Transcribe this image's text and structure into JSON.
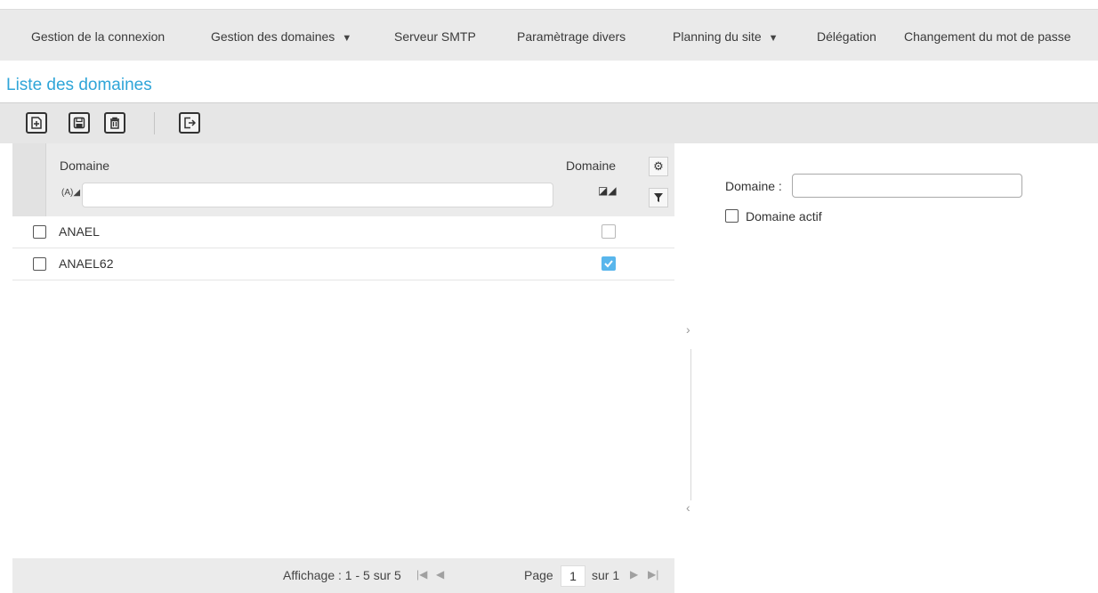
{
  "menu": {
    "items": [
      {
        "label": "Gestion de la connexion",
        "has_dropdown": false
      },
      {
        "label": "Gestion des domaines",
        "has_dropdown": true
      },
      {
        "label": "Serveur SMTP",
        "has_dropdown": false
      },
      {
        "label": "Paramètrage divers",
        "has_dropdown": false
      },
      {
        "label": "Planning du site",
        "has_dropdown": true
      },
      {
        "label": "Délégation",
        "has_dropdown": false
      },
      {
        "label": "Changement du mot de passe",
        "has_dropdown": false
      }
    ]
  },
  "page": {
    "title": "Liste des domaines"
  },
  "toolbar": {
    "buttons": [
      "new-icon",
      "save-icon",
      "delete-icon",
      "exit-icon"
    ]
  },
  "grid": {
    "columns": {
      "name": "Domaine",
      "active": "Domaine"
    },
    "filter_mode": "(A)",
    "rows": [
      {
        "name": "ANAEL",
        "active": false,
        "selected": false
      },
      {
        "name": "ANAEL62",
        "active": true,
        "selected": false
      }
    ]
  },
  "pager": {
    "info": "Affichage : 1 - 5 sur 5",
    "page_label": "Page",
    "page_value": "1",
    "total": "sur 1"
  },
  "form": {
    "domain_label": "Domaine :",
    "domain_value": "",
    "active_label": "Domaine actif",
    "active_checked": false
  },
  "colors": {
    "accent": "#2fa5d8",
    "checkbox_checked": "#59b6ec"
  }
}
